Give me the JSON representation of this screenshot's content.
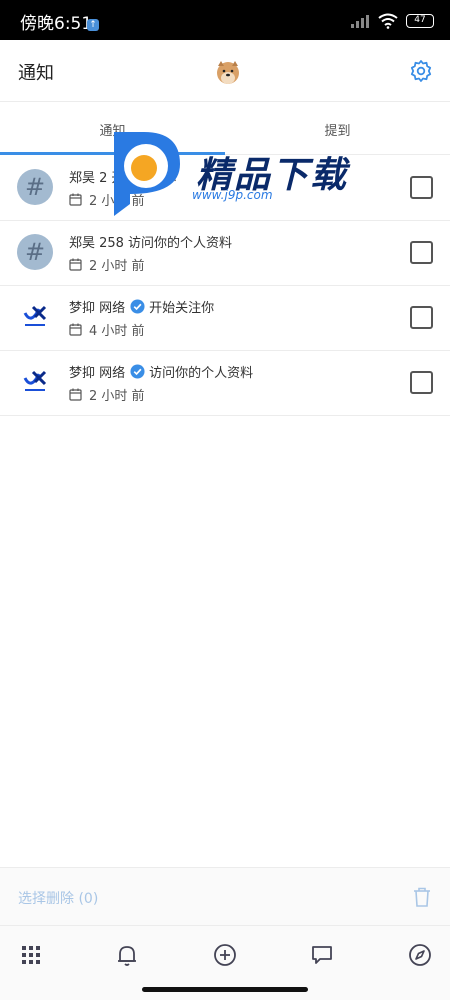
{
  "status_bar": {
    "time": "傍晚6:51",
    "battery": "47"
  },
  "header": {
    "title": "通知"
  },
  "tabs": [
    {
      "label": "通知",
      "active": true
    },
    {
      "label": "提到",
      "active": false
    }
  ],
  "notifications": [
    {
      "user": "郑昊 2",
      "action": "开始关注你",
      "time": "2 小时 前",
      "avatar": "hash-icon",
      "verified": false
    },
    {
      "user": "郑昊 258",
      "action": "访问你的个人资料",
      "time": "2 小时 前",
      "avatar": "hash-icon",
      "verified": false
    },
    {
      "user": "梦抑 网络",
      "action": "开始关注你",
      "time": "4 小时 前",
      "avatar": "logo",
      "verified": true
    },
    {
      "user": "梦抑 网络",
      "action": "访问你的个人资料",
      "time": "2 小时 前",
      "avatar": "logo",
      "verified": true
    }
  ],
  "watermark": {
    "text": "精品下载",
    "url": "www.j9p.com"
  },
  "bottom_action": {
    "delete_label": "选择删除 (0)"
  },
  "colors": {
    "accent": "#3a8ee6",
    "muted_blue": "#a9c6e6",
    "hash_avatar": "#a3bad0"
  }
}
